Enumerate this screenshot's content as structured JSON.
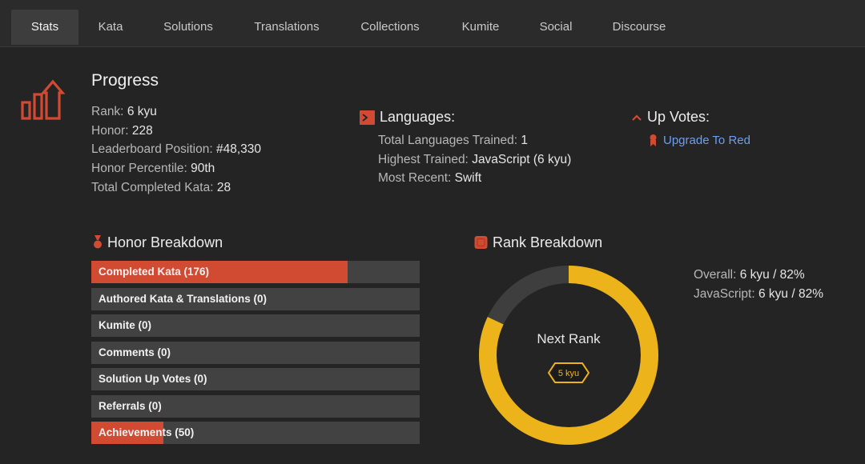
{
  "tabs": [
    {
      "label": "Stats",
      "active": true
    },
    {
      "label": "Kata"
    },
    {
      "label": "Solutions"
    },
    {
      "label": "Translations"
    },
    {
      "label": "Collections"
    },
    {
      "label": "Kumite"
    },
    {
      "label": "Social"
    },
    {
      "label": "Discourse"
    }
  ],
  "progress": {
    "title": "Progress",
    "icon": "bar-chart-arrow-icon",
    "rank_label": "Rank:",
    "rank_value": "6 kyu",
    "honor_label": "Honor:",
    "honor_value": "228",
    "leaderboard_label": "Leaderboard Position:",
    "leaderboard_value": "#48,330",
    "percentile_label": "Honor Percentile:",
    "percentile_value": "90th",
    "completed_label": "Total Completed Kata:",
    "completed_value": "28"
  },
  "languages": {
    "title": "Languages:",
    "icon": "terminal-icon",
    "total_label": "Total Languages Trained:",
    "total_value": "1",
    "highest_label": "Highest Trained:",
    "highest_value": "JavaScript (6 kyu)",
    "recent_label": "Most Recent:",
    "recent_value": "Swift"
  },
  "upvotes": {
    "title": "Up Votes:",
    "icon": "chevron-up-icon",
    "link_icon": "ribbon-icon",
    "link_label": "Upgrade To Red"
  },
  "honor_breakdown": {
    "title": "Honor Breakdown",
    "icon": "medal-icon",
    "bars": [
      {
        "label": "Completed Kata (176)",
        "fill": 0.78
      },
      {
        "label": "Authored Kata & Translations (0)",
        "fill": 0
      },
      {
        "label": "Kumite (0)",
        "fill": 0
      },
      {
        "label": "Comments (0)",
        "fill": 0
      },
      {
        "label": "Solution Up Votes (0)",
        "fill": 0
      },
      {
        "label": "Referrals (0)",
        "fill": 0
      },
      {
        "label": "Achievements (50)",
        "fill": 0.22
      }
    ]
  },
  "rank_breakdown": {
    "title": "Rank Breakdown",
    "icon": "rank-badge-icon",
    "progress_fraction": 0.82,
    "center_label": "Next Rank",
    "badge_label": "5 kyu",
    "overall_label": "Overall:",
    "overall_value": "6 kyu / 82%",
    "javascript_label": "JavaScript:",
    "javascript_value": "6 kyu / 82%"
  },
  "colors": {
    "accent": "#d14a32",
    "rank_yellow": "#ecb41a",
    "link": "#6c9ff0",
    "background": "#242424"
  }
}
